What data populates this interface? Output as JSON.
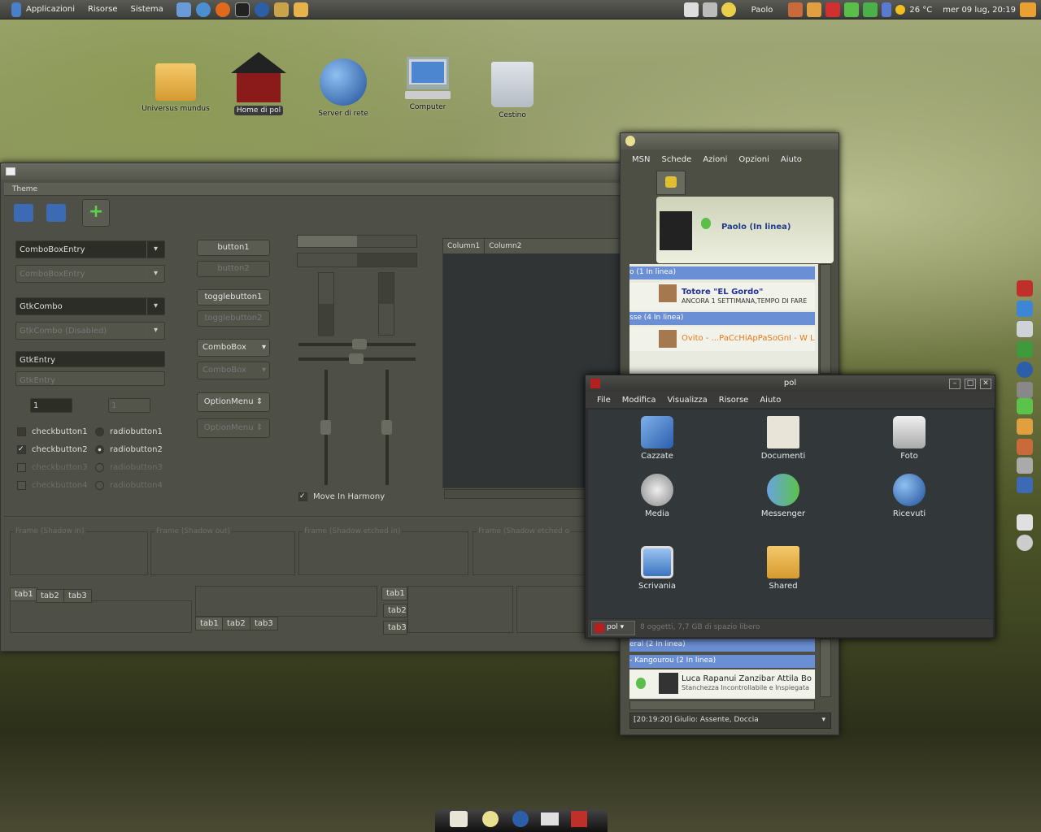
{
  "panel": {
    "menus": [
      "Applicazioni",
      "Risorse",
      "Sistema"
    ],
    "user": "Paolo",
    "weather": "26 °C",
    "clock": "mer 09 lug, 20:19"
  },
  "desktop": {
    "icons": [
      "Universus mundus",
      "Home di pol",
      "Server di rete",
      "Computer",
      "Cestino"
    ]
  },
  "theme": {
    "title": "Theme",
    "combo_entry": "ComboBoxEntry",
    "combo_entry_dis": "ComboBoxEntry",
    "gtkcombo": "GtkCombo",
    "gtkcombo_dis": "GtkCombo (Disabled)",
    "gtkentry": "GtkEntry",
    "gtkentry_dis": "GtkEntry",
    "spin1": "1",
    "spin2": "1",
    "checks": [
      "checkbutton1",
      "checkbutton2",
      "checkbutton3",
      "checkbutton4"
    ],
    "radios": [
      "radiobutton1",
      "radiobutton2",
      "radiobutton3",
      "radiobutton4"
    ],
    "buttons": [
      "button1",
      "button2",
      "togglebutton1",
      "togglebutton2",
      "ComboBox",
      "ComboBox",
      "OptionMenu",
      "OptionMenu"
    ],
    "harmony": "Move In Harmony",
    "columns": [
      "Column1",
      "Column2"
    ],
    "frames": [
      "Frame (Shadow in)",
      "Frame (Shadow out)",
      "Frame (Shadow etched in)",
      "Frame (Shadow etched o"
    ],
    "tabs": [
      "tab1",
      "tab2",
      "tab3"
    ]
  },
  "msn": {
    "menu": [
      "MSN",
      "Schede",
      "Azioni",
      "Opzioni",
      "Aiuto"
    ],
    "me": "Paolo (In linea)",
    "groups": [
      "o   (1 In linea)",
      "sse   (4 In linea)",
      "eral   (2 In linea)",
      "-  Kangourou   (2 In linea)"
    ],
    "contacts": [
      {
        "name": "Totore \"EL Gordo\"",
        "msg": "ANCORA 1 SETTIMANA,TEMPO DI FARE"
      },
      {
        "name": "Ovito - ...PaCcHiApPaSoGnI - W L",
        "msg": ""
      },
      {
        "name": "Luca Rapanui Zanzibar Attila Bo",
        "msg": "Stanchezza Incontrollabile e Inspiegata"
      }
    ],
    "status": "[20:19:20] Giulio: Assente, Doccia"
  },
  "pol": {
    "title": "pol",
    "menu": [
      "File",
      "Modifica",
      "Visualizza",
      "Risorse",
      "Aiuto"
    ],
    "items": [
      "Cazzate",
      "Documenti",
      "Foto",
      "Media",
      "Messenger",
      "Ricevuti",
      "Scrivania",
      "Shared"
    ],
    "location": "pol",
    "status": "8 oggetti, 7,7 GB di spazio libero"
  }
}
